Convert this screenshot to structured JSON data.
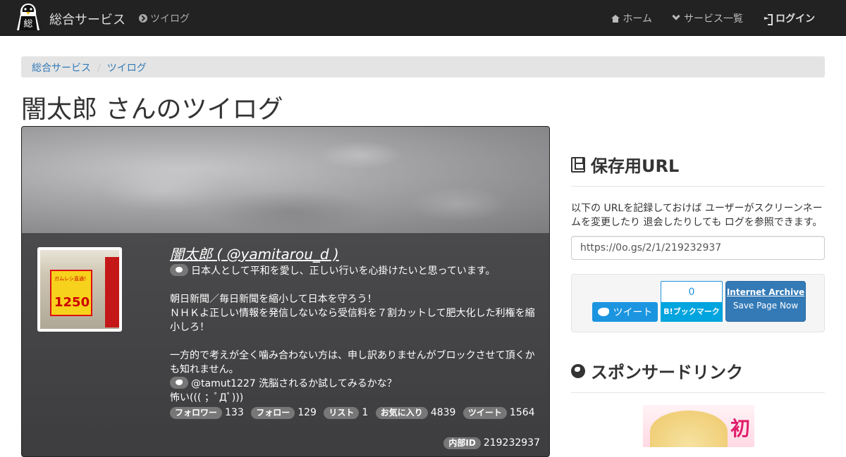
{
  "navbar": {
    "brand": "総合サービス",
    "logo_kanji": "総",
    "sub_link": "ツイログ",
    "home": "ホーム",
    "services": "サービス一覧",
    "login": "ログイン"
  },
  "breadcrumb": [
    "総合サービス",
    "ツイログ"
  ],
  "page_title": "闇太郎 さんのツイログ",
  "profile": {
    "name": "闇太郎 ( @yamitarou_d )",
    "bio_line1": "日本人として平和を愛し、正しい行いを心掛けたいと思っています。",
    "bio_line2": "朝日新聞／毎日新聞を縮小して日本を守ろう！",
    "bio_line3": "ＮＨＫよ正しい情報を発信しないなら受信料を７割カットして肥大化した利権を縮小しろ！",
    "bio_line4": "一方的で考えが全く噛み合わない方は、申し訳ありませんがブロックさせて頂くかも知れません。",
    "tweet_line1": "@tamut1227 洗脳されるか試してみるかな？",
    "tweet_line2": "怖い((( ；ﾟДﾟ)))",
    "stats": [
      {
        "label": "フォロワー",
        "value": "133"
      },
      {
        "label": "フォロー",
        "value": "129"
      },
      {
        "label": "リスト",
        "value": "1"
      },
      {
        "label": "お気に入り",
        "value": "4839"
      },
      {
        "label": "ツイート",
        "value": "1564"
      }
    ],
    "internal_label": "内部ID",
    "internal_id": "219232937",
    "avatar_sign": "ガムレシ直通！",
    "avatar_price": "1250"
  },
  "save_panel": {
    "title": "保存用URL",
    "description": "以下の URLを記録しておけば ユーザーがスクリーンネームを変更したり 退会したりしても ログを参照できます。",
    "url": "https://0o.gs/2/1/219232937"
  },
  "share": {
    "tweet_label": "ツイート",
    "hatena_count": "0",
    "hatena_label": "B!ブックマーク",
    "ia_line1": "Internet Archive",
    "ia_line2": "Save Page Now"
  },
  "sponsor": {
    "title": "スポンサードリンク",
    "image_text": "初"
  },
  "colors": {
    "navbar_bg": "#222222",
    "link": "#337ab7",
    "twitter": "#1b95e0",
    "hatena": "#00a4de",
    "ia": "#337ab7"
  }
}
